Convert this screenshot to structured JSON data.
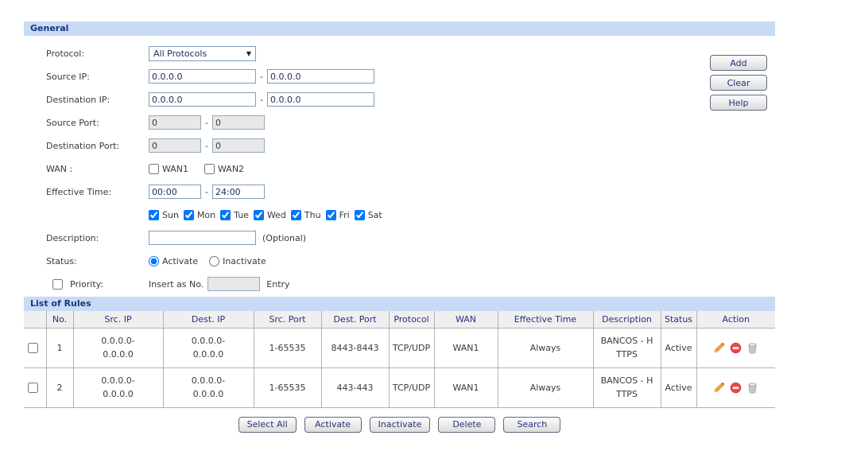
{
  "general": {
    "title": "General",
    "sep": "-",
    "fields": {
      "protocol": {
        "label": "Protocol:",
        "value": "All Protocols"
      },
      "source_ip": {
        "label": "Source IP:",
        "value1": "0.0.0.0",
        "value2": "0.0.0.0"
      },
      "destination_ip": {
        "label": "Destination IP:",
        "value1": "0.0.0.0",
        "value2": "0.0.0.0"
      },
      "source_port": {
        "label": "Source Port:",
        "value1": "0",
        "value2": "0"
      },
      "destination_port": {
        "label": "Destination Port:",
        "value1": "0",
        "value2": "0"
      },
      "wan": {
        "label": "WAN :",
        "options": [
          "WAN1",
          "WAN2"
        ]
      },
      "effective_time": {
        "label": "Effective Time:",
        "from": "00:00",
        "to": "24:00"
      },
      "days": [
        "Sun",
        "Mon",
        "Tue",
        "Wed",
        "Thu",
        "Fri",
        "Sat"
      ],
      "description": {
        "label": "Description:",
        "value": "",
        "hint": "(Optional)"
      },
      "status": {
        "label": "Status:",
        "option1": "Activate",
        "option2": "Inactivate",
        "selected": "Activate"
      },
      "priority": {
        "label": "Priority:",
        "insert_label": "Insert as No.",
        "entry_label": "Entry",
        "value": ""
      }
    },
    "buttons": [
      "Add",
      "Clear",
      "Help"
    ]
  },
  "rules": {
    "title": "List of Rules",
    "columns": [
      "No.",
      "Src. IP",
      "Dest. IP",
      "Src. Port",
      "Dest. Port",
      "Protocol",
      "WAN",
      "Effective Time",
      "Description",
      "Status",
      "Action"
    ],
    "rows": [
      {
        "no": "1",
        "src_ip": "0.0.0.0-\n0.0.0.0",
        "dest_ip": "0.0.0.0-\n0.0.0.0",
        "src_port": "1-65535",
        "dest_port": "8443-8443",
        "protocol": "TCP/UDP",
        "wan": "WAN1",
        "effective_time": "Always",
        "description": "BANCOS - H\nTTPS",
        "status": "Active"
      },
      {
        "no": "2",
        "src_ip": "0.0.0.0-\n0.0.0.0",
        "dest_ip": "0.0.0.0-\n0.0.0.0",
        "src_port": "1-65535",
        "dest_port": "443-443",
        "protocol": "TCP/UDP",
        "wan": "WAN1",
        "effective_time": "Always",
        "description": "BANCOS - H\nTTPS",
        "status": "Active"
      }
    ]
  },
  "footer": {
    "buttons": [
      "Select All",
      "Activate",
      "Inactivate",
      "Delete",
      "Search"
    ]
  },
  "colors": {
    "section_bar_bg": "#c8daf5",
    "section_bar_text": "#16387f",
    "table_header_bg": "#efefef",
    "table_header_text": "#26337e",
    "cell_text": "#3a3a3a",
    "input_border": "#7f9db9",
    "disabled_input_bg": "#e8e8e8",
    "button_text": "#26317a",
    "icon_pencil": "#f5a623",
    "icon_minus": "#e8494a",
    "icon_trash": "#c8c8c8"
  }
}
